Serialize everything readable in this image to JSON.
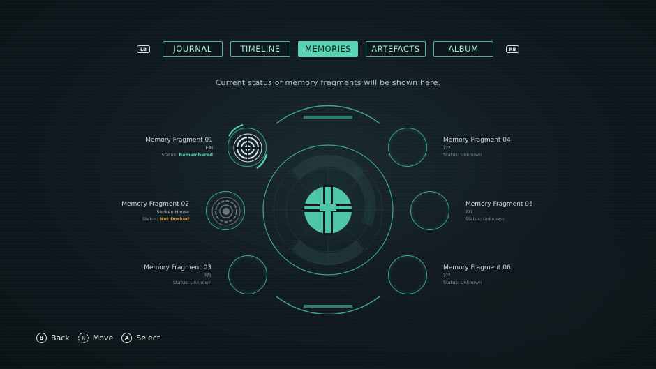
{
  "tabs": {
    "left_bumper": "LB",
    "right_bumper": "RB",
    "items": [
      {
        "label": "JOURNAL"
      },
      {
        "label": "TIMELINE"
      },
      {
        "label": "MEMORIES"
      },
      {
        "label": "ARTEFACTS"
      },
      {
        "label": "ALBUM"
      }
    ],
    "active": "MEMORIES"
  },
  "subtitle": "Current status of memory fragments will be shown here.",
  "status_prefix": "Status:",
  "fragments": [
    {
      "name": "Memory Fragment 01",
      "location": "EAI",
      "status": "Remembered"
    },
    {
      "name": "Memory Fragment 02",
      "location": "Sunken House",
      "status": "Not Docked"
    },
    {
      "name": "Memory Fragment 03",
      "location": "???",
      "status": "Unknown"
    },
    {
      "name": "Memory Fragment 04",
      "location": "???",
      "status": "Unknown"
    },
    {
      "name": "Memory Fragment 05",
      "location": "???",
      "status": "Unknown"
    },
    {
      "name": "Memory Fragment 06",
      "location": "???",
      "status": "Unknown"
    }
  ],
  "controls": [
    {
      "button": "B",
      "label": "Back"
    },
    {
      "button": "R",
      "label": "Move"
    },
    {
      "button": "A",
      "label": "Select"
    }
  ],
  "colors": {
    "accent": "#5ad4b3",
    "ring": "#3fa68a",
    "not_docked": "#e0a040",
    "background": "#101b20"
  }
}
